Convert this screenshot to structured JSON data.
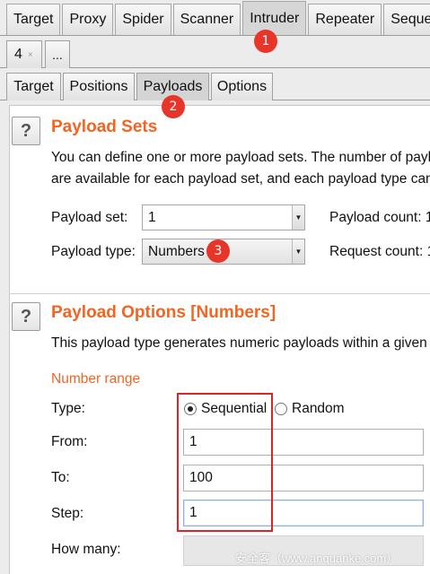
{
  "top_tabs": [
    "Target",
    "Proxy",
    "Spider",
    "Scanner",
    "Intruder",
    "Repeater",
    "Sequencer"
  ],
  "top_active": "Intruder",
  "attack_tab": {
    "number": "4",
    "close": "×",
    "more": "..."
  },
  "inner_tabs": [
    "Target",
    "Positions",
    "Payloads",
    "Options"
  ],
  "inner_active": "Payloads",
  "payload_sets": {
    "title": "Payload Sets",
    "desc_line1": "You can define one or more payload sets. The number of payl",
    "desc_line2": "are available for each payload set, and each payload type can",
    "set_label": "Payload set:",
    "set_value": "1",
    "type_label": "Payload type:",
    "type_value": "Numbers",
    "count_label": "Payload count:",
    "count_value": "1",
    "request_label": "Request count:",
    "request_value": "1"
  },
  "payload_options": {
    "title": "Payload Options [Numbers]",
    "desc": "This payload type generates numeric payloads within a given",
    "section": "Number range",
    "type_label": "Type:",
    "radio_sequential": "Sequential",
    "radio_random": "Random",
    "selected": "Sequential",
    "from_label": "From:",
    "from_value": "1",
    "to_label": "To:",
    "to_value": "100",
    "step_label": "Step:",
    "step_value": "1",
    "howmany_label": "How many:"
  },
  "markers": [
    "1",
    "2",
    "3"
  ],
  "help_icon": "?",
  "dropdown_arrow": "▼",
  "watermark": "安全客（www.anquanke.com）",
  "colors": {
    "accent": "#f26522",
    "marker": "#e8352a",
    "highlight_box": "#e02424"
  }
}
